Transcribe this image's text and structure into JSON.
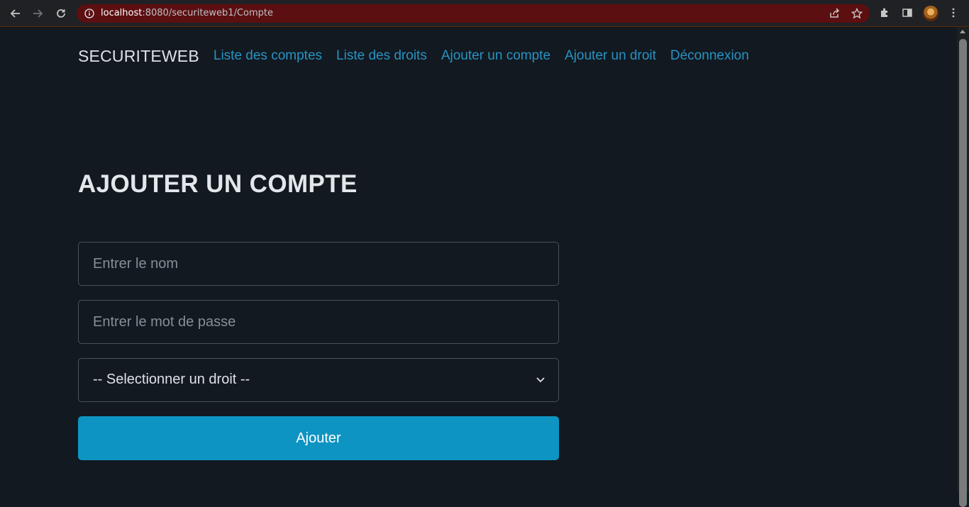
{
  "browser": {
    "url_host": "localhost",
    "url_rest": ":8080/securiteweb1/Compte"
  },
  "navbar": {
    "brand": "SECURITEWEB",
    "links": [
      "Liste des comptes",
      "Liste des droits",
      "Ajouter un compte",
      "Ajouter un droit",
      "Déconnexion"
    ],
    "link_color": "#2793c4"
  },
  "page": {
    "title": "AJOUTER UN COMPTE"
  },
  "form": {
    "name_placeholder": "Entrer le nom",
    "password_placeholder": "Entrer le mot de passe",
    "droit_selected": "-- Selectionner un droit --",
    "submit_label": "Ajouter",
    "submit_color": "#0e94c2"
  }
}
